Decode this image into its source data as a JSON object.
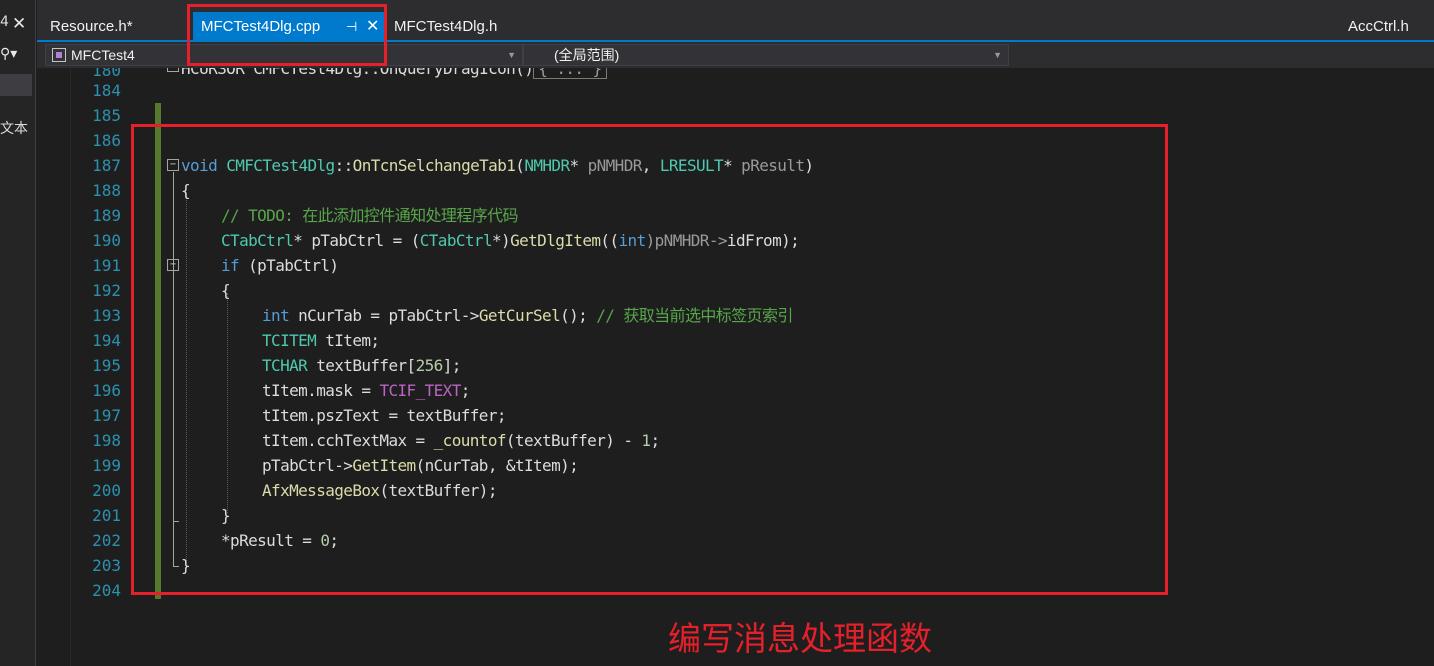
{
  "left_panel": {
    "top_fragment": "4",
    "close_glyph": "✕",
    "search_glyph": "⚲▾",
    "text_fragment": "文本"
  },
  "tabs": [
    {
      "label": "Resource.h*",
      "active": false
    },
    {
      "label": "MFCTest4Dlg.cpp",
      "active": true,
      "pin_glyph": "⊣",
      "close_glyph": "✕"
    },
    {
      "label": "MFCTest4Dlg.h",
      "active": false
    },
    {
      "label": "AccCtrl.h",
      "active": false
    }
  ],
  "navbar": {
    "project": "MFCTest4",
    "scope": "(全局范围)"
  },
  "line_numbers": [
    "180",
    "184",
    "185",
    "186",
    "187",
    "188",
    "189",
    "190",
    "191",
    "192",
    "193",
    "194",
    "195",
    "196",
    "197",
    "198",
    "199",
    "200",
    "201",
    "202",
    "203",
    "204"
  ],
  "code": {
    "collapsed_prefix": "HCURSOR CMFCTest4Dlg::OnQueryDragIcon()",
    "collapsed_box": "{ ... }",
    "l187": {
      "kw": "void",
      "cls": "CMFCTest4Dlg",
      "sep": "::",
      "fn": "OnTcnSelchangeTab1",
      "p1": "(",
      "t1": "NMHDR",
      "star1": "*",
      "a1": " pNMHDR",
      "comma": ", ",
      "t2": "LRESULT",
      "star2": "*",
      "a2": " pResult",
      "p2": ")"
    },
    "l188": "{",
    "l189": "// TODO: 在此添加控件通知处理程序代码",
    "l190": {
      "t": "CTabCtrl",
      "a": "* pTabCtrl = (",
      "t2": "CTabCtrl",
      "b": "*)",
      "fn": "GetDlgItem",
      "c": "((",
      "kw": "int",
      "d": ")pNMHDR->",
      "e": "idFrom",
      "f": ");"
    },
    "l191": {
      "kw": "if",
      "a": " (pTabCtrl)"
    },
    "l192": "{",
    "l193": {
      "kw": "int",
      "a": " nCurTab = pTabCtrl->",
      "fn": "GetCurSel",
      "b": "(); ",
      "cm": "// 获取当前选中标签页索引"
    },
    "l194": {
      "t": "TCITEM",
      "a": " tItem;"
    },
    "l195": {
      "t": "TCHAR",
      "a": " textBuffer[",
      "n": "256",
      "b": "];"
    },
    "l196": {
      "a": "tItem.mask = ",
      "m": "TCIF_TEXT",
      "b": ";"
    },
    "l197": "tItem.pszText = textBuffer;",
    "l198": {
      "a": "tItem.cchTextMax = ",
      "fn": "_countof",
      "b": "(textBuffer) - ",
      "n": "1",
      "c": ";"
    },
    "l199": {
      "a": "pTabCtrl->",
      "fn": "GetItem",
      "b": "(nCurTab, &tItem);"
    },
    "l200": {
      "fn": "AfxMessageBox",
      "a": "(textBuffer);"
    },
    "l201": "}",
    "l202": {
      "a": "*pResult = ",
      "n": "0",
      "b": ";"
    },
    "l203": "}"
  },
  "annotation": {
    "caption": "编写消息处理函数",
    "color": "#e5202a"
  },
  "colors": {
    "accent": "#007acc",
    "keyword": "#569cd6",
    "type": "#4ec9b0",
    "function": "#dcdcaa",
    "comment": "#57a64a",
    "line_number": "#2b91af"
  }
}
